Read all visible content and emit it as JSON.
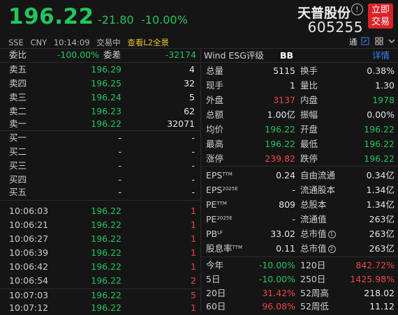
{
  "header": {
    "price": "196.22",
    "change": "-21.80",
    "change_pct": "-10.00%",
    "stock_name": "天普股份",
    "info_icon": "!",
    "stock_code": "605255",
    "trade_button": [
      "立即",
      "交易"
    ]
  },
  "subline": {
    "exchange": "SSE",
    "currency": "CNY",
    "time": "10:14:09",
    "status": "交易中",
    "l2_link": "查看L2全景",
    "tong": "通"
  },
  "book": {
    "weibi_label": "委比",
    "weibi_value": "-100.00%",
    "weicha_label": "委差",
    "weicha_value": "-32174",
    "asks": [
      {
        "label": "卖五",
        "price": "196.29",
        "vol": "4"
      },
      {
        "label": "卖四",
        "price": "196.25",
        "vol": "32"
      },
      {
        "label": "卖三",
        "price": "196.24",
        "vol": "5"
      },
      {
        "label": "卖二",
        "price": "196.23",
        "vol": "62"
      },
      {
        "label": "卖一",
        "price": "196.22",
        "vol": "32071"
      }
    ],
    "bids": [
      {
        "label": "买一",
        "price": "-",
        "vol": "-"
      },
      {
        "label": "买二",
        "price": "-",
        "vol": "-"
      },
      {
        "label": "买三",
        "price": "-",
        "vol": "-"
      },
      {
        "label": "买四",
        "price": "-",
        "vol": "-"
      },
      {
        "label": "买五",
        "price": "-",
        "vol": "-"
      }
    ]
  },
  "ticks": [
    {
      "time": "10:06:03",
      "price": "196.22",
      "vol": "1"
    },
    {
      "time": "10:06:21",
      "price": "196.22",
      "vol": "1"
    },
    {
      "time": "10:06:27",
      "price": "196.22",
      "vol": "1"
    },
    {
      "time": "10:06:39",
      "price": "196.22",
      "vol": "1"
    },
    {
      "time": "10:06:42",
      "price": "196.22",
      "vol": "1"
    },
    {
      "time": "10:06:54",
      "price": "196.22",
      "vol": "2"
    },
    {
      "time": "10:07:03",
      "price": "196.22",
      "vol": "5"
    },
    {
      "time": "10:07:12",
      "price": "196.22",
      "vol": "1"
    }
  ],
  "esg": {
    "label": "Wind ESG评级",
    "rating": "BB",
    "detail": "详情"
  },
  "stats": [
    {
      "l1": "总量",
      "v1": "5115",
      "c1": "white",
      "l2": "换手",
      "v2": "0.38%",
      "c2": "white"
    },
    {
      "l1": "现手",
      "v1": "1",
      "c1": "white",
      "l2": "量比",
      "v2": "1.30",
      "c2": "white"
    },
    {
      "l1": "外盘",
      "v1": "3137",
      "c1": "red",
      "l2": "内盘",
      "v2": "1978",
      "c2": "green"
    },
    {
      "l1": "总额",
      "v1": "1.00亿",
      "c1": "white",
      "l2": "振幅",
      "v2": "0.00%",
      "c2": "white"
    },
    {
      "l1": "均价",
      "v1": "196.22",
      "c1": "green",
      "l2": "开盘",
      "v2": "196.22",
      "c2": "green"
    },
    {
      "l1": "最高",
      "v1": "196.22",
      "c1": "green",
      "l2": "最低",
      "v2": "196.22",
      "c2": "green"
    },
    {
      "l1": "涨停",
      "v1": "239.82",
      "c1": "red",
      "l2": "跌停",
      "v2": "196.22",
      "c2": "green"
    }
  ],
  "fundamentals": [
    {
      "l1": "EPS",
      "s1": "TTM",
      "v1": "0.24",
      "l2": "自由流通",
      "s2": "",
      "v2": "0.34亿"
    },
    {
      "l1": "EPS",
      "s1": "2025E",
      "v1": "-",
      "l2": "流通股本",
      "s2": "",
      "v2": "1.34亿"
    },
    {
      "l1": "PE",
      "s1": "TTM",
      "v1": "809",
      "l2": "总股本",
      "s2": "",
      "v2": "1.34亿"
    },
    {
      "l1": "PE",
      "s1": "2025E",
      "v1": "-",
      "l2": "流通值",
      "s2": "",
      "v2": "263亿"
    },
    {
      "l1": "PB",
      "s1": "LF",
      "v1": "33.02",
      "l2": "总市值",
      "s2": "1",
      "v2": "263亿"
    },
    {
      "l1": "股息率",
      "s1": "TTM",
      "v1": "0.11",
      "l2": "总市值",
      "s2": "2",
      "v2": "263亿"
    }
  ],
  "periods": [
    {
      "l1": "今年",
      "v1": "-10.00%",
      "c1": "green",
      "l2": "120日",
      "v2": "842.72%",
      "c2": "red"
    },
    {
      "l1": "5日",
      "v1": "-10.00%",
      "c1": "green",
      "l2": "250日",
      "v2": "1425.98%",
      "c2": "red"
    },
    {
      "l1": "20日",
      "v1": "31.42%",
      "c1": "red",
      "l2": "52周高",
      "v2": "218.02",
      "c2": "white"
    },
    {
      "l1": "60日",
      "v1": "96.08%",
      "c1": "red",
      "l2": "52周低",
      "v2": "11.12",
      "c2": "white"
    }
  ]
}
